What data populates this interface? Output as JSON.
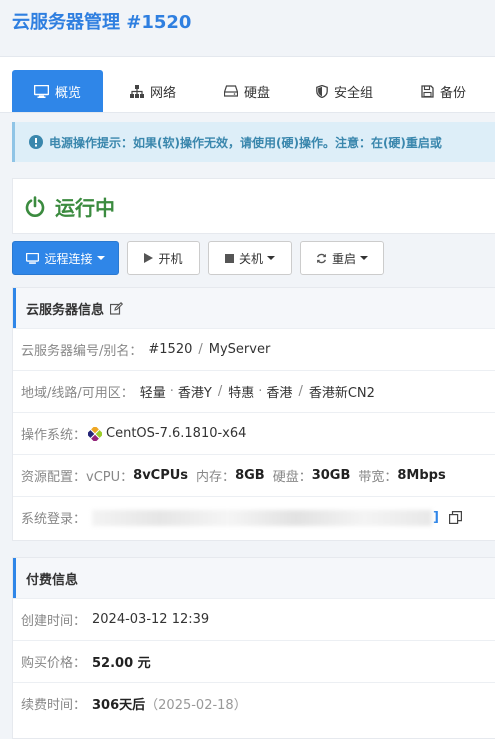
{
  "page": {
    "title": "云服务器管理 #1520"
  },
  "tabs": [
    {
      "label": "概览",
      "icon": "monitor-icon",
      "active": true
    },
    {
      "label": "网络",
      "icon": "network-icon"
    },
    {
      "label": "硬盘",
      "icon": "hdd-icon"
    },
    {
      "label": "安全组",
      "icon": "shield-icon"
    },
    {
      "label": "备份",
      "icon": "save-icon"
    }
  ],
  "alert": {
    "icon": "exclamation-circle-icon",
    "text": "电源操作提示：如果(软)操作无效，请使用(硬)操作。注意：在(硬)重启或"
  },
  "status": {
    "icon": "power-icon",
    "text": "运行中",
    "color": "#3b8b3f"
  },
  "actions": {
    "remote": "远程连接",
    "start": "开机",
    "shutdown": "关机",
    "restart": "重启"
  },
  "server_info": {
    "title": "云服务器信息",
    "title_icon": "edit-icon",
    "id_label": "云服务器编号/别名：",
    "id_value": "#1520",
    "alias": "MyServer",
    "region_label": "地域/线路/可用区：",
    "region_parts": [
      "轻量",
      "香港Y",
      "特惠",
      "香港",
      "香港新CN2"
    ],
    "os_label": "操作系统：",
    "os_icon": "centos-logo-icon",
    "os_value": "CentOS-7.6.1810-x64",
    "config_label": "资源配置：",
    "vcpu_label": "vCPU：",
    "vcpu_value": "8vCPUs",
    "mem_label": "内存：",
    "mem_value": "8GB",
    "disk_label": "硬盘：",
    "disk_value": "30GB",
    "bw_label": "带宽：",
    "bw_value": "8Mbps",
    "login_label": "系统登录：",
    "login_copy_icon": "copy-icon"
  },
  "billing": {
    "title": "付费信息",
    "created_label": "创建时间：",
    "created_value": "2024-03-12 12:39",
    "price_label": "购买价格：",
    "price_value": "52.00 元",
    "renew_label": "续费时间：",
    "renew_value": "306天后",
    "renew_date": "（2025-02-18）"
  },
  "colors": {
    "accent": "#2f86e8",
    "title": "#2f7fe0",
    "running": "#3b8b3f",
    "alert_bg": "#ddeef8"
  }
}
